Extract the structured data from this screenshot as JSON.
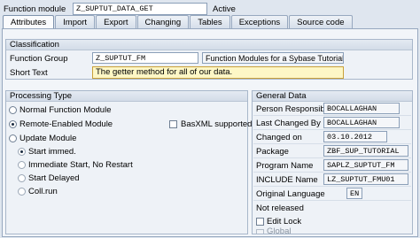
{
  "header": {
    "label": "Function module",
    "value": "Z_SUPTUT_DATA_GET",
    "status": "Active"
  },
  "tabs": [
    "Attributes",
    "Import",
    "Export",
    "Changing",
    "Tables",
    "Exceptions",
    "Source code"
  ],
  "classification": {
    "title": "Classification",
    "function_group_label": "Function Group",
    "function_group_value": "Z_SUPTUT_FM",
    "function_group_desc": "Function Modules for a Sybase Tutorial",
    "short_text_label": "Short Text",
    "short_text_value": "The getter method for all of our data."
  },
  "processing": {
    "title": "Processing Type",
    "normal": "Normal Function Module",
    "remote": "Remote-Enabled Module",
    "basxml": "BasXML supported",
    "update": "Update Module",
    "start_immed": "Start immed.",
    "immed_no_restart": "Immediate Start, No Restart",
    "start_delayed": "Start Delayed",
    "collrun": "Coll.run"
  },
  "general": {
    "title": "General Data",
    "rows": [
      {
        "label": "Person Responsible",
        "value": "BOCALLAGHAN"
      },
      {
        "label": "Last Changed By",
        "value": "BOCALLAGHAN"
      },
      {
        "label": "Changed on",
        "value": "03.10.2012"
      },
      {
        "label": "Package",
        "value": "ZBF_SUP_TUTORIAL"
      },
      {
        "label": "Program Name",
        "value": "SAPLZ_SUPTUT_FM"
      },
      {
        "label": "INCLUDE Name",
        "value": "LZ_SUPTUT_FMU01"
      },
      {
        "label": "Original Language",
        "value": "EN"
      }
    ],
    "not_released": "Not released",
    "edit_lock": "Edit Lock",
    "global": "Global"
  }
}
